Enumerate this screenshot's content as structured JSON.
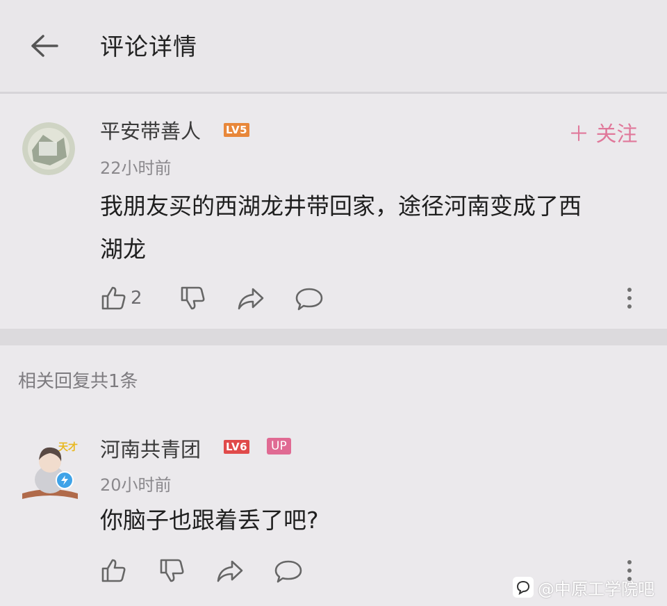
{
  "header": {
    "title": "评论详情"
  },
  "main_comment": {
    "username": "平安带善人",
    "level_badge": "LV5",
    "timestamp": "22小时前",
    "follow_label": "＋ 关注",
    "text_line1": "我朋友买的西湖龙井带回家，途径河南变成了西",
    "text_line2": "湖龙",
    "like_count": "2"
  },
  "replies": {
    "count_label": "相关回复共1条"
  },
  "reply": {
    "username": "河南共青团",
    "level_badge": "LV6",
    "up_badge": "UP",
    "timestamp": "20小时前",
    "text": "你脑子也跟着丢了吧?"
  },
  "watermark": {
    "text": "@中原工学院吧"
  },
  "colors": {
    "accent_pink": "#e0789a",
    "lv5_orange": "#e8873a",
    "lv6_red": "#e04a4a",
    "up_pink": "#e06a93"
  },
  "icons": [
    "back-arrow-icon",
    "thumbs-up-icon",
    "thumbs-down-icon",
    "share-icon",
    "comment-icon",
    "more-vertical-icon",
    "verified-icon"
  ]
}
